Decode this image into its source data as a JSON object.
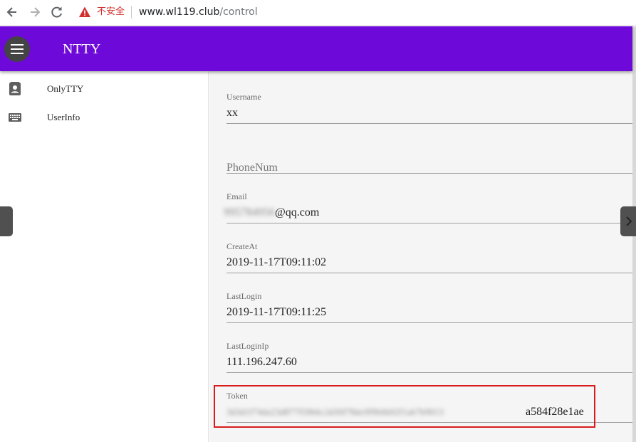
{
  "browser": {
    "security_label": "不安全",
    "url_host": "www.wl119.club",
    "url_path": "/control",
    "colors": {
      "warning": "#d32f2f"
    }
  },
  "appbar": {
    "title": "NTTY",
    "menu_icon": "menu-icon",
    "color": "#6d0ad9"
  },
  "sidebar": {
    "items": [
      {
        "label": "OnlyTTY",
        "icon": "contact-icon"
      },
      {
        "label": "UserInfo",
        "icon": "keyboard-icon"
      }
    ]
  },
  "form": {
    "username": {
      "label": "Username",
      "value": "xx"
    },
    "phone": {
      "placeholder": "PhoneNum"
    },
    "email": {
      "label": "Email",
      "value_hidden": "995784956",
      "value_visible": "@qq.com"
    },
    "create_at": {
      "label": "CreateAt",
      "value": "2019-11-17T09:11:02"
    },
    "last_login": {
      "label": "LastLogin",
      "value": "2019-11-17T09:11:25"
    },
    "last_login_ip": {
      "label": "LastLoginIp",
      "value": "111.196.247.60"
    },
    "token": {
      "label": "Token",
      "value_hidden": "3d3d1f74da23d877f59b6c2d30f78dc0f9b6b02f1ab7b9013",
      "value_visible": "a584f28e1ae"
    }
  }
}
